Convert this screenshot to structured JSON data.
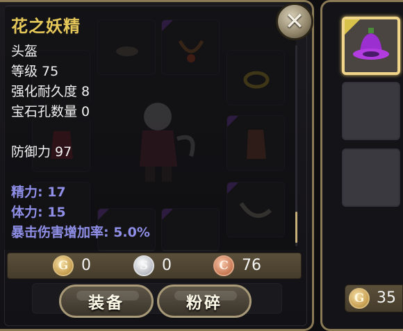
{
  "item": {
    "name": "花之妖精",
    "type": "头盔",
    "level_label": "等级 75",
    "durability_label": "强化耐久度 8",
    "sockets_label": "宝石孔数量 0",
    "defense_label": "防御力 97",
    "bonuses": [
      "精力: 17",
      "体力: 15",
      "暴击伤害增加率: 5.0%"
    ]
  },
  "currency": {
    "gold": "0",
    "silver": "0",
    "copper": "76",
    "gold_symbol": "G",
    "silver_symbol": "S",
    "copper_symbol": "C"
  },
  "actions": {
    "equip_label": "装备",
    "smash_label": "粉碎"
  },
  "close_symbol": "✕",
  "side": {
    "coin_value": "35",
    "coin_symbol": "G"
  },
  "colors": {
    "title": "#e6c85a",
    "bonus_text": "#8f8fe8",
    "frame": "#8a7a55",
    "selected_slot": "#f0d58a",
    "hat_purple": "#9b2fd0"
  },
  "icons": [
    "close-icon",
    "gold-coin-icon",
    "silver-coin-icon",
    "copper-coin-icon",
    "purple-hat-icon"
  ]
}
